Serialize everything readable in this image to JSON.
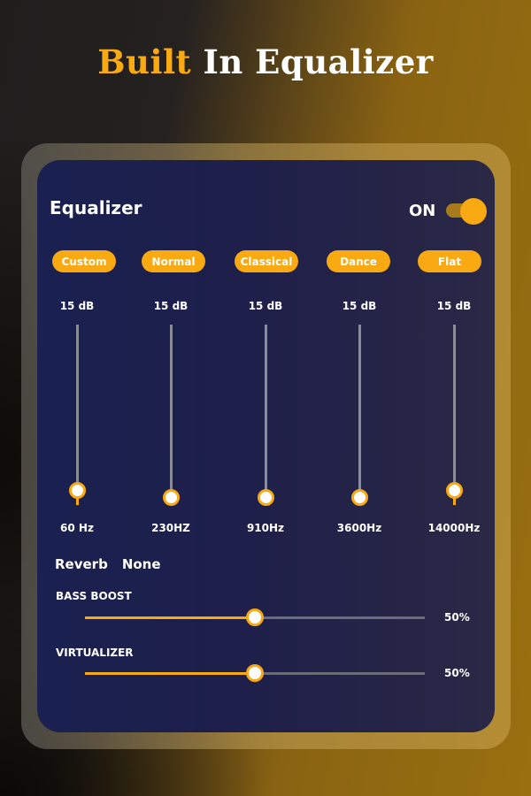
{
  "headline": {
    "accent": "Built",
    "rest": " In Equalizer"
  },
  "equalizer": {
    "title": "Equalizer",
    "power_label": "ON",
    "power_on": true,
    "presets": [
      "Custom",
      "Normal",
      "Classical",
      "Dance",
      "Flat"
    ],
    "bands": [
      {
        "gain_label": "15 dB",
        "frequency": "60 Hz",
        "level": 0.92
      },
      {
        "gain_label": "15 dB",
        "frequency": "230HZ",
        "level": 0.96
      },
      {
        "gain_label": "15 dB",
        "frequency": "910Hz",
        "level": 0.96
      },
      {
        "gain_label": "15 dB",
        "frequency": "3600Hz",
        "level": 0.96
      },
      {
        "gain_label": "15 dB",
        "frequency": "14000Hz",
        "level": 0.92
      }
    ],
    "reverb": {
      "label": "Reverb",
      "value": "None"
    },
    "bass_boost": {
      "label": "BASS BOOST",
      "value_label": "50%",
      "value": 0.5
    },
    "virtualizer": {
      "label": "VIRTUALIZER",
      "value_label": "50%",
      "value": 0.5
    }
  },
  "colors": {
    "accent": "#f9a912",
    "panel": "#1e1f4a",
    "track": "#8a8d99"
  }
}
